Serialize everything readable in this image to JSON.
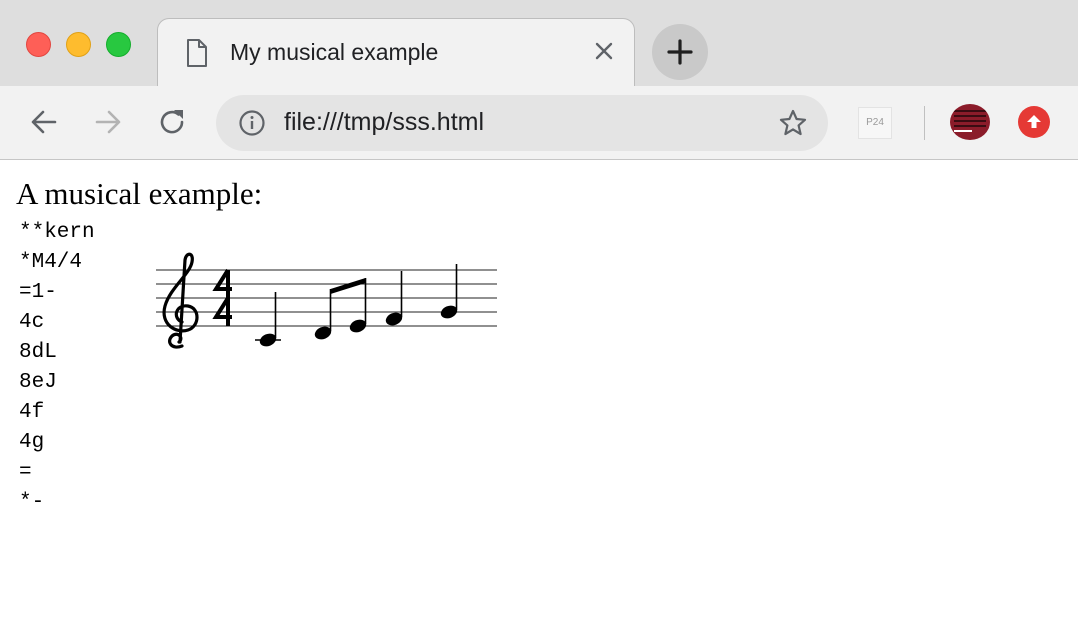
{
  "window": {
    "traffic_lights": [
      "close",
      "minimize",
      "zoom"
    ]
  },
  "tab": {
    "title": "My musical example",
    "icon": "document-icon",
    "close_icon": "close-icon"
  },
  "new_tab": {
    "icon": "plus-icon"
  },
  "toolbar": {
    "back_icon": "back-arrow-icon",
    "forward_icon": "forward-arrow-icon",
    "reload_icon": "reload-icon",
    "url": "file:///tmp/sss.html",
    "info_icon": "info-icon",
    "bookmark_icon": "star-icon",
    "extensions": [
      {
        "name": "p24-extension",
        "label": "P24"
      },
      {
        "name": "avatar-extension"
      },
      {
        "name": "upload-extension",
        "icon": "upload-arrow-icon",
        "color": "#e53935"
      }
    ]
  },
  "page": {
    "heading": "A musical example:",
    "kern_lines": [
      "**kern",
      "*M4/4",
      "=1-",
      "4c",
      "8dL",
      "8eJ",
      "4f",
      "4g",
      "=",
      "*-"
    ],
    "notation": {
      "clef": "treble",
      "time_signature": "4/4",
      "notes": [
        {
          "pitch": "c",
          "duration": "quarter"
        },
        {
          "pitch": "d",
          "duration": "eighth",
          "beam": "start"
        },
        {
          "pitch": "e",
          "duration": "eighth",
          "beam": "end"
        },
        {
          "pitch": "f",
          "duration": "quarter"
        },
        {
          "pitch": "g",
          "duration": "quarter"
        }
      ]
    }
  },
  "colors": {
    "tabstrip_bg": "#dedede",
    "toolbar_bg": "#f2f2f2",
    "close_light": "#fe5f57",
    "minimize_light": "#febc2e",
    "zoom_light": "#28c840"
  }
}
